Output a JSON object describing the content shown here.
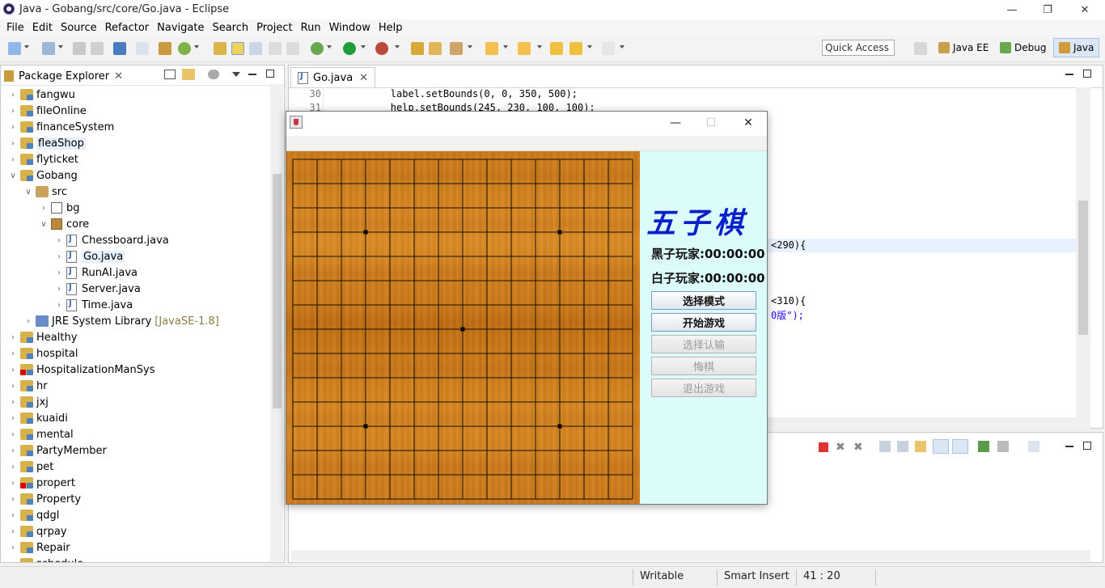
{
  "window": {
    "title": "Java - Gobang/src/core/Go.java - Eclipse"
  },
  "menu": [
    "File",
    "Edit",
    "Source",
    "Refactor",
    "Navigate",
    "Search",
    "Project",
    "Run",
    "Window",
    "Help"
  ],
  "toolbar": {
    "quick_access": "Quick Access"
  },
  "perspectives": [
    "Java EE",
    "Debug",
    "Java"
  ],
  "package_explorer": {
    "title": "Package Explorer",
    "items": [
      {
        "label": "fangwu",
        "depth": 0,
        "kind": "project",
        "open": false
      },
      {
        "label": "fileOnline",
        "depth": 0,
        "kind": "project",
        "open": false
      },
      {
        "label": "financeSystem",
        "depth": 0,
        "kind": "project",
        "open": false
      },
      {
        "label": "fleaShop",
        "depth": 0,
        "kind": "project",
        "open": false,
        "selected": true
      },
      {
        "label": "flyticket",
        "depth": 0,
        "kind": "project",
        "open": false
      },
      {
        "label": "Gobang",
        "depth": 0,
        "kind": "project",
        "open": true
      },
      {
        "label": "src",
        "depth": 1,
        "kind": "src",
        "open": true
      },
      {
        "label": "bg",
        "depth": 2,
        "kind": "package-empty",
        "open": false
      },
      {
        "label": "core",
        "depth": 2,
        "kind": "package",
        "open": true
      },
      {
        "label": "Chessboard.java",
        "depth": 3,
        "kind": "java",
        "open": false
      },
      {
        "label": "Go.java",
        "depth": 3,
        "kind": "java",
        "open": false,
        "selected": true
      },
      {
        "label": "RunAI.java",
        "depth": 3,
        "kind": "java",
        "open": false
      },
      {
        "label": "Server.java",
        "depth": 3,
        "kind": "java",
        "open": false
      },
      {
        "label": "Time.java",
        "depth": 3,
        "kind": "java",
        "open": false
      },
      {
        "label": "JRE System Library",
        "depth": 1,
        "kind": "lib",
        "open": false,
        "suffix": "[JavaSE-1.8]"
      },
      {
        "label": "Healthy",
        "depth": 0,
        "kind": "project",
        "open": false
      },
      {
        "label": "hospital",
        "depth": 0,
        "kind": "project",
        "open": false
      },
      {
        "label": "HospitalizationManSys",
        "depth": 0,
        "kind": "project-err",
        "open": false
      },
      {
        "label": "hr",
        "depth": 0,
        "kind": "project",
        "open": false
      },
      {
        "label": "jxj",
        "depth": 0,
        "kind": "project",
        "open": false
      },
      {
        "label": "kuaidi",
        "depth": 0,
        "kind": "project",
        "open": false
      },
      {
        "label": "mental",
        "depth": 0,
        "kind": "project",
        "open": false
      },
      {
        "label": "PartyMember",
        "depth": 0,
        "kind": "project",
        "open": false
      },
      {
        "label": "pet",
        "depth": 0,
        "kind": "project",
        "open": false
      },
      {
        "label": "propert",
        "depth": 0,
        "kind": "project-err",
        "open": false
      },
      {
        "label": "Property",
        "depth": 0,
        "kind": "project",
        "open": false
      },
      {
        "label": "qdgl",
        "depth": 0,
        "kind": "project",
        "open": false
      },
      {
        "label": "qrpay",
        "depth": 0,
        "kind": "project",
        "open": false
      },
      {
        "label": "Repair",
        "depth": 0,
        "kind": "project",
        "open": false
      },
      {
        "label": "schedule",
        "depth": 0,
        "kind": "project",
        "open": false
      }
    ]
  },
  "editor": {
    "tab": "Go.java",
    "lines": [
      {
        "no": "30",
        "code": "        label.setBounds(0, 0, 350, 500);"
      },
      {
        "no": "31",
        "code": "        help.setBounds(245, 230, 100, 100);"
      }
    ],
    "fragments": [
      "<290){",
      "<310){",
      "0版\");"
    ]
  },
  "status": {
    "mode": "Writable",
    "insert": "Smart Insert",
    "position": "41 : 20"
  },
  "game": {
    "title_glyphs": [
      "五",
      "子",
      "棋"
    ],
    "black_timer": "黑子玩家:00:00:00",
    "white_timer": "白子玩家:00:00:00",
    "buttons": [
      {
        "label": "选择模式",
        "enabled": true
      },
      {
        "label": "开始游戏",
        "enabled": true
      },
      {
        "label": "选择认输",
        "enabled": false
      },
      {
        "label": "悔棋",
        "enabled": false
      },
      {
        "label": "退出游戏",
        "enabled": false
      }
    ],
    "board": {
      "lines": 15,
      "star_points": [
        [
          3,
          3
        ],
        [
          11,
          3
        ],
        [
          7,
          7
        ],
        [
          3,
          11
        ],
        [
          11,
          11
        ]
      ]
    }
  }
}
